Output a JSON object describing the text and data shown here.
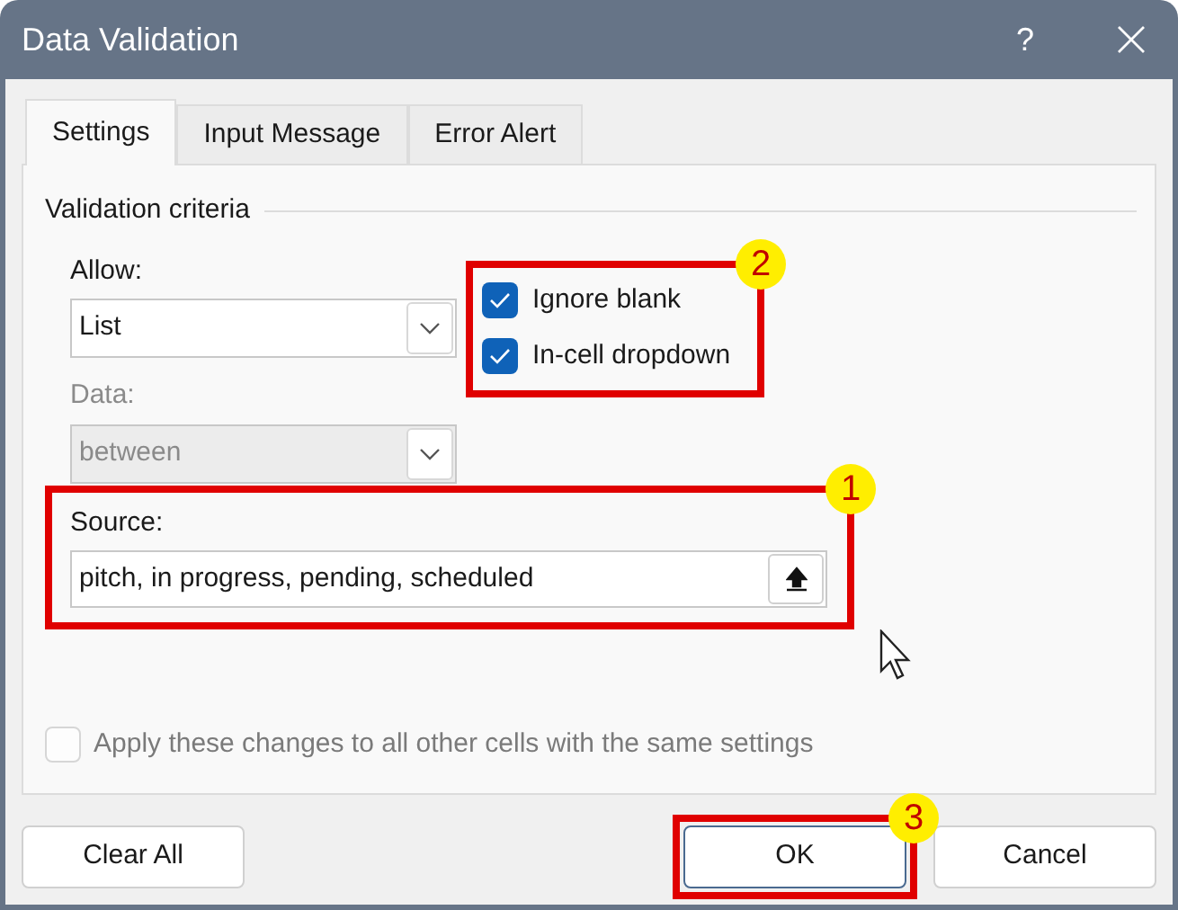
{
  "window": {
    "title": "Data Validation",
    "help": "?"
  },
  "tabs": [
    {
      "label": "Settings",
      "selected": true
    },
    {
      "label": "Input Message",
      "selected": false
    },
    {
      "label": "Error Alert",
      "selected": false
    }
  ],
  "section_title": "Validation criteria",
  "allow": {
    "label": "Allow:",
    "value": "List",
    "disabled": false
  },
  "data": {
    "label": "Data:",
    "value": "between",
    "disabled": true
  },
  "options": {
    "callout": "2",
    "items": [
      {
        "label": "Ignore blank",
        "checked": true
      },
      {
        "label": "In-cell dropdown",
        "checked": true
      }
    ]
  },
  "source": {
    "label": "Source:",
    "value": "pitch, in progress, pending, scheduled",
    "callout": "1"
  },
  "apply_all": {
    "label": "Apply these changes to all other cells with the same settings",
    "checked": false,
    "disabled": true
  },
  "buttons": [
    {
      "label": "Clear All",
      "focused": false
    },
    {
      "label": "OK",
      "focused": true,
      "callout": "3"
    },
    {
      "label": "Cancel",
      "focused": false
    }
  ]
}
